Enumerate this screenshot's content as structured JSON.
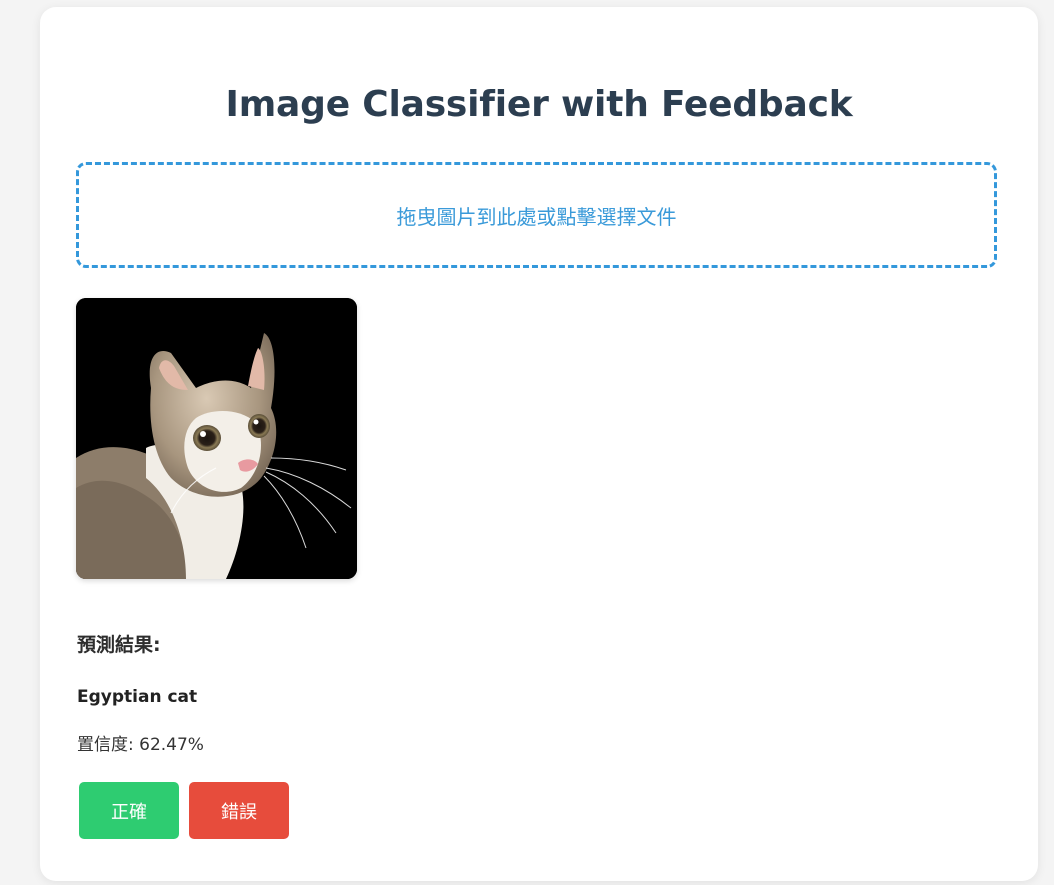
{
  "header": {
    "title": "Image Classifier with Feedback"
  },
  "upload": {
    "dropzone_text": "拖曳圖片到此處或點擊選擇文件"
  },
  "preview": {
    "icon": "cat-photo"
  },
  "result": {
    "heading": "預測結果:",
    "label": "Egyptian cat",
    "confidence_text": "置信度: 62.47%",
    "confidence_value": 62.47
  },
  "feedback": {
    "correct_label": "正確",
    "wrong_label": "錯誤"
  },
  "colors": {
    "title": "#2c3e50",
    "accent": "#3498db",
    "correct": "#2ecc71",
    "wrong": "#e74c3c"
  }
}
